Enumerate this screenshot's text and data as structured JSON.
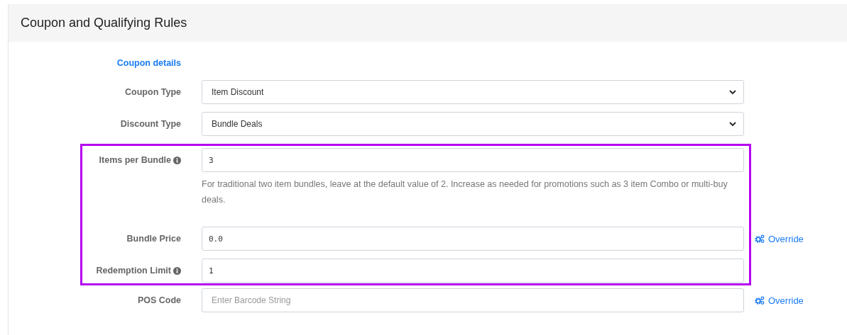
{
  "panel": {
    "title": "Coupon and Qualifying Rules"
  },
  "section_link": "Coupon details",
  "fields": [
    {
      "kind": "select",
      "label": "Coupon Type",
      "info": false,
      "value": "Item Discount",
      "highlighted": false
    },
    {
      "kind": "select",
      "label": "Discount Type",
      "info": false,
      "value": "Bundle Deals",
      "highlighted": false
    },
    {
      "kind": "input",
      "label": "Items per Bundle",
      "info": true,
      "value": "3",
      "help": "For traditional two item bundles, leave at the default value of 2. Increase as needed for promotions such as 3 item Combo or multi-buy deals.",
      "highlighted": true
    },
    {
      "kind": "input",
      "label": "Bundle Price",
      "info": false,
      "value": "0.0",
      "action": "Override",
      "highlighted": true
    },
    {
      "kind": "input",
      "label": "Redemption Limit",
      "info": true,
      "value": "1",
      "highlighted": true
    },
    {
      "kind": "input",
      "label": "POS Code",
      "info": false,
      "placeholder": "Enter Barcode String",
      "action": "Override",
      "highlighted": false
    }
  ]
}
